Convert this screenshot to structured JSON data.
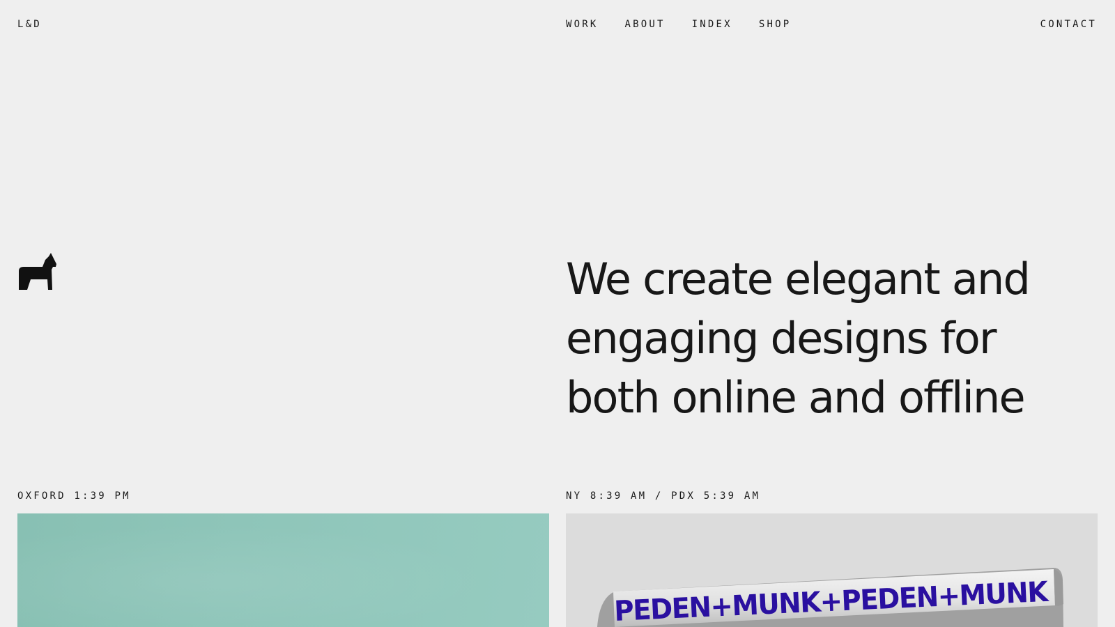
{
  "header": {
    "brand": "L&D",
    "nav": [
      {
        "label": "WORK"
      },
      {
        "label": "ABOUT"
      },
      {
        "label": "INDEX"
      },
      {
        "label": "SHOP"
      }
    ],
    "contact": "CONTACT"
  },
  "hero": {
    "logo_icon": "horse-icon",
    "headline": "We create elegant and engaging designs for both online and offline"
  },
  "clocks": {
    "left": "OXFORD 1:39 PM",
    "right": "NY 8:39 AM / PDX 5:39 AM"
  },
  "projects": [
    {
      "color": "#8ec5b9"
    },
    {
      "color": "#dcdcdc",
      "wordmark": "PEDEN+MUNK+PEDEN+MUNK",
      "wordmark_color": "#2a10a0"
    }
  ]
}
